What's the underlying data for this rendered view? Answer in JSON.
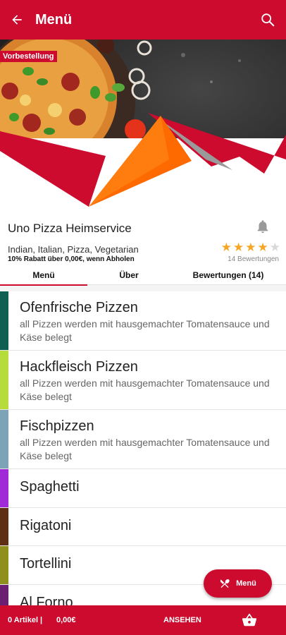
{
  "header": {
    "title": "Menü",
    "back_icon": "arrow-left-icon",
    "search_icon": "search-icon"
  },
  "hero": {
    "badge": "Vorbestellung",
    "accent": "#cc0b2f",
    "accent2": "#ff6a00"
  },
  "restaurant": {
    "name": "Uno Pizza Heimservice",
    "cuisines": "Indian, Italian, Pizza, Vegetarian",
    "discount": "10% Rabatt über 0,00€, wenn Abholen",
    "rating": 4,
    "rating_max": 5,
    "reviews": "14 Bewertungen"
  },
  "tabs": [
    {
      "label": "Menü",
      "active": true
    },
    {
      "label": "Über",
      "active": false
    },
    {
      "label": "Bewertungen (14)",
      "active": false
    }
  ],
  "categories": [
    {
      "name": "Ofenfrische Pizzen",
      "desc": "all Pizzen werden mit hausgemachter Tomatensauce und Käse belegt",
      "color": "#0f5f52"
    },
    {
      "name": "Hackfleisch Pizzen",
      "desc": "all Pizzen werden mit hausgemachter Tomatensauce und Käse belegt",
      "color": "#b5dc3a"
    },
    {
      "name": "Fischpizzen",
      "desc": "all Pizzen werden mit hausgemachter Tomatensauce und Käse belegt",
      "color": "#7da3b6"
    },
    {
      "name": "Spaghetti",
      "desc": "",
      "color": "#a12ad8"
    },
    {
      "name": "Rigatoni",
      "desc": "",
      "color": "#5e2f12"
    },
    {
      "name": "Tortellini",
      "desc": "",
      "color": "#8f8f1e"
    },
    {
      "name": "Al Forno",
      "desc": "",
      "color": "#6a1f70"
    }
  ],
  "fab": {
    "label": "Menü"
  },
  "footer": {
    "cart_count": "0 Artikel |",
    "cart_total": "0,00€",
    "view_label": "ANSEHEN"
  }
}
